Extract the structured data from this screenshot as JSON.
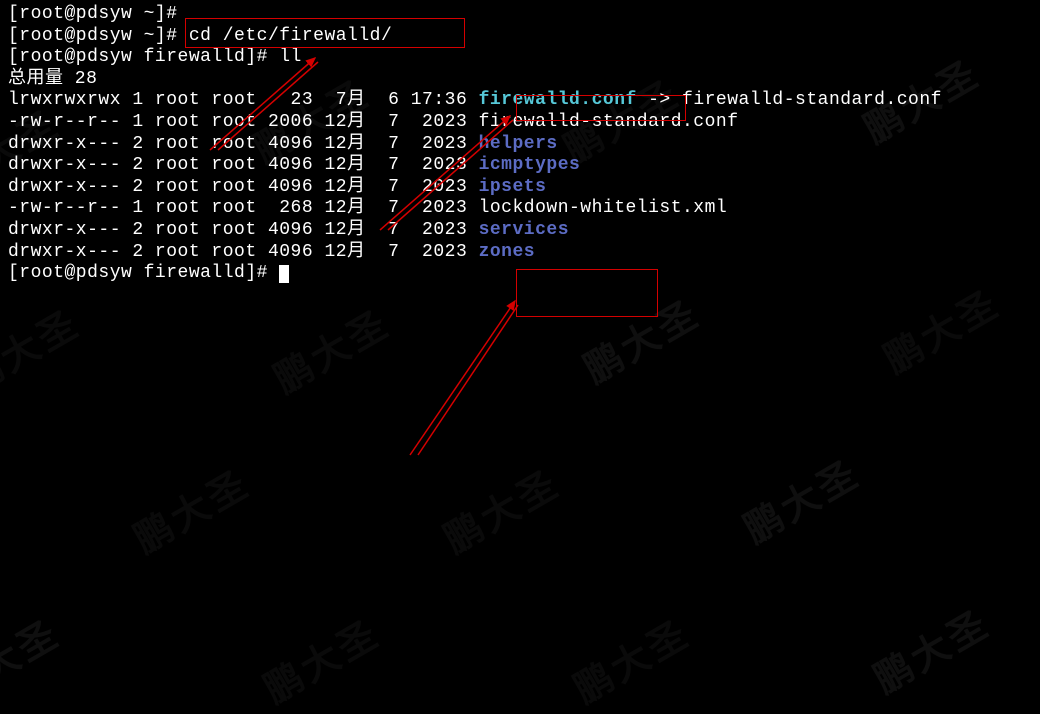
{
  "lines": {
    "l1": "[root@pdsyw ~]#",
    "l2_prompt": "[root@pdsyw ~]# ",
    "l2_cmd": "cd /etc/firewalld/",
    "l3_prompt": "[root@pdsyw firewalld]# ",
    "l3_cmd": "ll",
    "l4": "总用量 28",
    "l5_pre": "lrwxrwxrwx 1 root root   23  7月  6 17:36 ",
    "l5_link": "firewalld.conf",
    "l5_post": " -> firewalld-standard.conf",
    "l6_pre": "-rw-r--r-- 1 root root 2006 12月  7  2023 ",
    "l6_file": "firewalld-standard.conf",
    "l7_pre": "drwxr-x--- 2 root root 4096 12月  7  2023 ",
    "l7_dir": "helpers",
    "l8_pre": "drwxr-x--- 2 root root 4096 12月  7  2023 ",
    "l8_dir": "icmptypes",
    "l9_pre": "drwxr-x--- 2 root root 4096 12月  7  2023 ",
    "l9_dir": "ipsets",
    "l10_pre": "-rw-r--r-- 1 root root  268 12月  7  2023 ",
    "l10_file": "lockdown-whitelist.xml",
    "l11_pre": "drwxr-x--- 2 root root 4096 12月  7  2023 ",
    "l11_dir": "services",
    "l12_pre": "drwxr-x--- 2 root root 4096 12月  7  2023 ",
    "l12_dir": "zones",
    "l13": "[root@pdsyw firewalld]# "
  },
  "watermark_text": "鹏大圣"
}
